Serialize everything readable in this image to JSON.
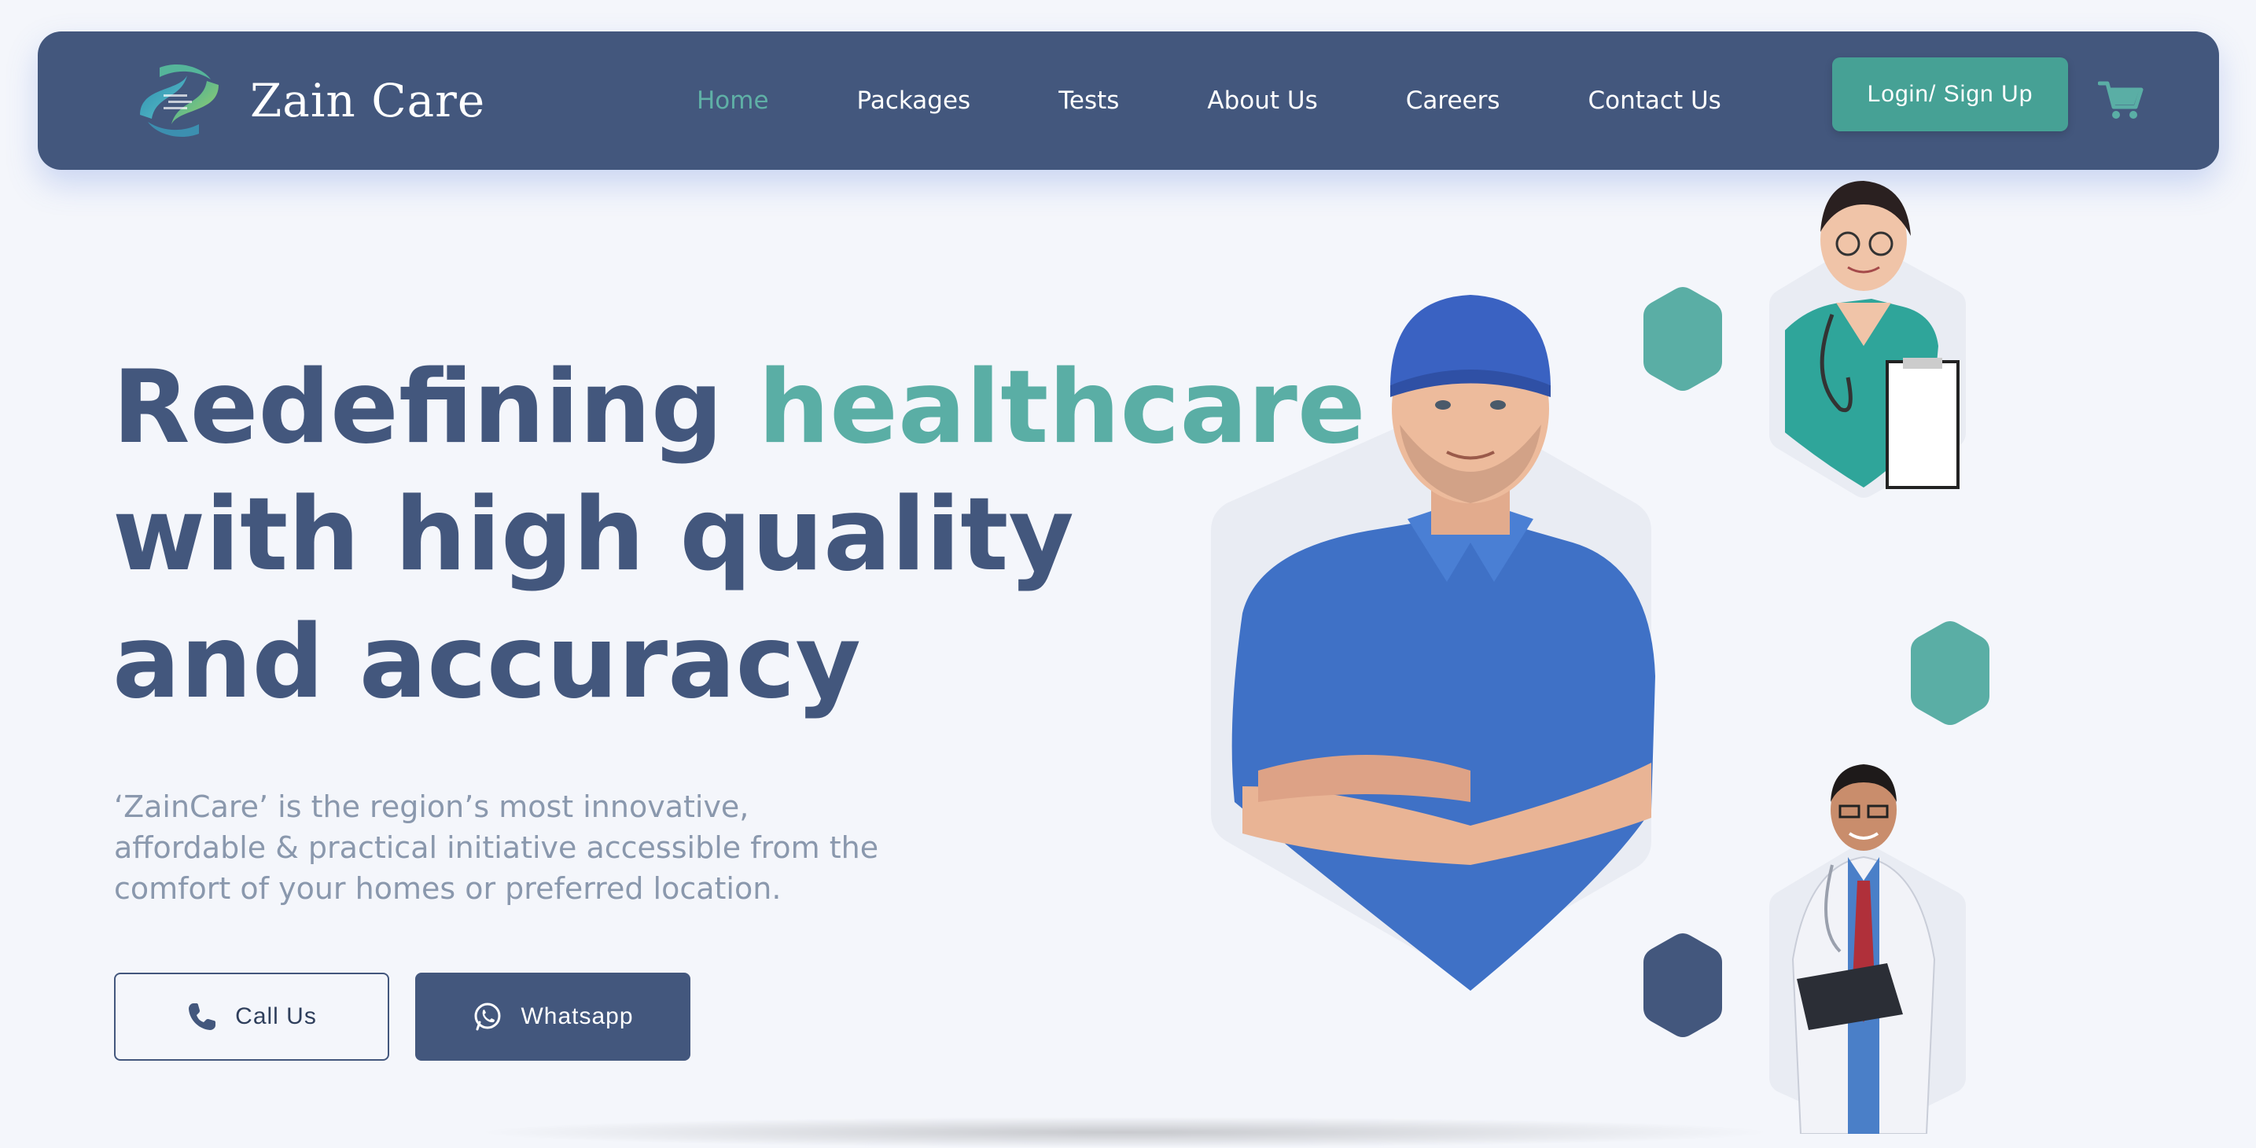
{
  "brand": {
    "name": "Zain Care",
    "colors": {
      "primary": "#43577d",
      "accent": "#5aaea5",
      "button": "#46a195",
      "background": "#f4f6fb"
    }
  },
  "nav": {
    "links": [
      {
        "label": "Home",
        "active": true
      },
      {
        "label": "Packages",
        "active": false
      },
      {
        "label": "Tests",
        "active": false
      },
      {
        "label": "About Us",
        "active": false
      },
      {
        "label": "Careers",
        "active": false
      },
      {
        "label": "Contact Us",
        "active": false
      }
    ],
    "login_label": "Login/ Sign Up",
    "cart_icon": "cart-icon"
  },
  "hero": {
    "headline_part1": "Redefining ",
    "headline_accent": "healthcare",
    "headline_line2": "with high quality",
    "headline_line3": "and accuracy",
    "description": "‘ZainCare’ is the region’s most innovative, affordable & practical initiative accessible from the comfort of your homes or preferred location.",
    "call_label": "Call Us",
    "call_icon": "phone-icon",
    "whatsapp_label": "Whatsapp",
    "whatsapp_icon": "whatsapp-icon"
  },
  "images": {
    "main_person": "technician-in-blue-polo-cap",
    "top_right_person": "nurse-with-stethoscope-clipboard",
    "bottom_right_person": "doctor-in-white-coat-with-clipboard",
    "decorative_hexagons": [
      {
        "color": "#5aaea5"
      },
      {
        "color": "#5aaea5"
      },
      {
        "color": "#43577d"
      }
    ]
  }
}
